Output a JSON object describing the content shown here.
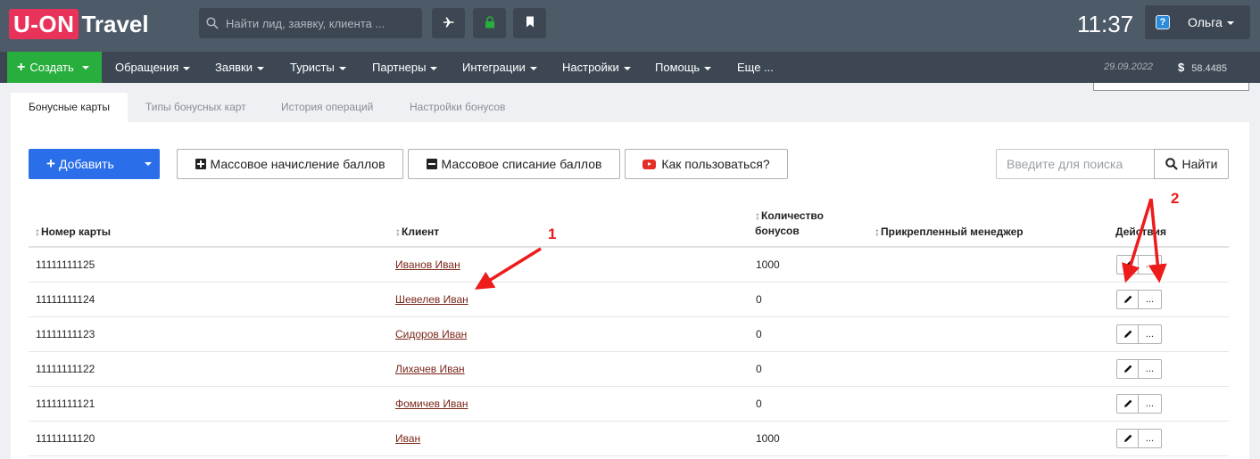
{
  "app": {
    "logo_part1": "U-ON",
    "logo_part2": "Travel",
    "search_placeholder": "Найти лид, заявку, клиента ...",
    "clock": "11:37",
    "user_name": "Ольга",
    "help_glyph": "?"
  },
  "nav": {
    "create": "Создать",
    "items": [
      "Обращения",
      "Заявки",
      "Туристы",
      "Партнеры",
      "Интеграции",
      "Настройки",
      "Помощь",
      "Еще ..."
    ],
    "date": "29.09.2022",
    "currency_symbol": "$",
    "rate": "58.4485"
  },
  "tabs": [
    "Бонусные карты",
    "Типы бонусных карт",
    "История операций",
    "Настройки бонусов"
  ],
  "toolbar": {
    "add": "Добавить",
    "mass_accrual": "Массовое начисление баллов",
    "mass_writeoff": "Массовое списание баллов",
    "how_to": "Как пользоваться?",
    "search_placeholder": "Введите для поиска",
    "search_button": "Найти"
  },
  "table": {
    "columns": {
      "card_number": "Номер карты",
      "client": "Клиент",
      "bonus_line1": "Количество",
      "bonus_line2": "бонусов",
      "manager": "Прикрепленный менеджер",
      "actions": "Действия"
    },
    "more_label": "...",
    "rows": [
      {
        "card": "11111111125",
        "client": "Иванов Иван",
        "bonus": "1000",
        "manager": ""
      },
      {
        "card": "11111111124",
        "client": "Шевелев Иван",
        "bonus": "0",
        "manager": ""
      },
      {
        "card": "11111111123",
        "client": "Сидоров Иван",
        "bonus": "0",
        "manager": ""
      },
      {
        "card": "11111111122",
        "client": "Лихачев Иван",
        "bonus": "0",
        "manager": ""
      },
      {
        "card": "11111111121",
        "client": "Фомичев Иван",
        "bonus": "0",
        "manager": ""
      },
      {
        "card": "11111111120",
        "client": "Иван",
        "bonus": "1000",
        "manager": ""
      }
    ]
  },
  "annotations": {
    "label1": "1",
    "label2": "2",
    "color": "#ee1b1b"
  },
  "colors": {
    "topbar": "#4d5b69",
    "navbar": "#3c4753",
    "brand": "#e8325a",
    "create": "#27ae3c",
    "primary": "#2b6eea",
    "link": "#7a2619"
  }
}
